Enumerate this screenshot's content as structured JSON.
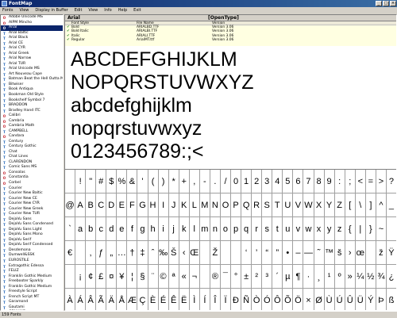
{
  "window": {
    "title": "FontMap"
  },
  "menu": [
    "Fonts",
    "View",
    "Display in Buffer",
    "Edit",
    "View",
    "Info",
    "Help",
    "Exit"
  ],
  "sidebar": {
    "fonts": [
      {
        "name": "Adobe Unicode MS",
        "type": "ot"
      },
      {
        "name": "AIPM Mincho",
        "type": "ot"
      },
      {
        "name": "Arial",
        "type": "ot",
        "selected": true
      },
      {
        "name": "Arial Baltic",
        "type": "tt"
      },
      {
        "name": "Arial Black",
        "type": "tt"
      },
      {
        "name": "Arial CE",
        "type": "tt"
      },
      {
        "name": "Arial CYR",
        "type": "tt"
      },
      {
        "name": "Arial Greek",
        "type": "tt"
      },
      {
        "name": "Arial Narrow",
        "type": "tt"
      },
      {
        "name": "Arial TUR",
        "type": "tt"
      },
      {
        "name": "Arial Unicode MS",
        "type": "tt"
      },
      {
        "name": "Art Nouveau Cape",
        "type": "tt"
      },
      {
        "name": "Batman Beat the Hell Outta Me",
        "type": "tt"
      },
      {
        "name": "Bitwiser",
        "type": "tt"
      },
      {
        "name": "Book Antiqua",
        "type": "tt"
      },
      {
        "name": "Bookman Old Style",
        "type": "tt"
      },
      {
        "name": "Bookshelf Symbol 7",
        "type": "tt"
      },
      {
        "name": "BRADDON",
        "type": "tt"
      },
      {
        "name": "Bradley Hand ITC",
        "type": "tt"
      },
      {
        "name": "Calibri",
        "type": "ot"
      },
      {
        "name": "Cambria",
        "type": "ot"
      },
      {
        "name": "Cambria Math",
        "type": "ot"
      },
      {
        "name": "CAMPBELL",
        "type": "tt"
      },
      {
        "name": "Candara",
        "type": "ot"
      },
      {
        "name": "Century",
        "type": "tt"
      },
      {
        "name": "Century Gothic",
        "type": "tt"
      },
      {
        "name": "Chat",
        "type": "tt"
      },
      {
        "name": "Chat Lines",
        "type": "tt"
      },
      {
        "name": "CLARENDON",
        "type": "tt"
      },
      {
        "name": "Comic Sans MS",
        "type": "tt"
      },
      {
        "name": "Consolas",
        "type": "ot"
      },
      {
        "name": "Constantia",
        "type": "ot"
      },
      {
        "name": "Corbel",
        "type": "ot"
      },
      {
        "name": "Courier",
        "type": "tt"
      },
      {
        "name": "Courier New Baltic",
        "type": "tt"
      },
      {
        "name": "Courier New CE",
        "type": "tt"
      },
      {
        "name": "Courier New CYR",
        "type": "tt"
      },
      {
        "name": "Courier New Greek",
        "type": "tt"
      },
      {
        "name": "Courier New TUR",
        "type": "tt"
      },
      {
        "name": "DejaVu Sans",
        "type": "tt"
      },
      {
        "name": "DejaVu Sans Condensed",
        "type": "tt"
      },
      {
        "name": "DejaVu Sans Light",
        "type": "tt"
      },
      {
        "name": "DejaVu Sans Mono",
        "type": "tt"
      },
      {
        "name": "DejaVu Serif",
        "type": "tt"
      },
      {
        "name": "DejaVu Serif Condensed",
        "type": "tt"
      },
      {
        "name": "Desdemona",
        "type": "tt"
      },
      {
        "name": "Dumwell&SSK",
        "type": "tt"
      },
      {
        "name": "EUROSTILE",
        "type": "tt"
      },
      {
        "name": "Extragothic Edessa",
        "type": "tt"
      },
      {
        "name": "FELIZ",
        "type": "tt"
      },
      {
        "name": "Franklin Gothic Medium",
        "type": "tt"
      },
      {
        "name": "Freebooter Sparkly",
        "type": "tt"
      },
      {
        "name": "Franklin Gothic Medium",
        "type": "tt"
      },
      {
        "name": "Freestyle Script",
        "type": "tt"
      },
      {
        "name": "French Script MT",
        "type": "tt"
      },
      {
        "name": "Garamond",
        "type": "tt"
      },
      {
        "name": "Gautami",
        "type": "tt"
      },
      {
        "name": "GENUINE",
        "type": "tt"
      },
      {
        "name": "Georgia",
        "type": "tt"
      }
    ]
  },
  "status": "159 Fonts",
  "font_header": {
    "name": "Arial",
    "type": "[OpenType]"
  },
  "style_table": {
    "headers": [
      "Font Style",
      "File Name",
      "Version",
      ""
    ],
    "rows": [
      [
        "Bold",
        "ARIALBD.TTF",
        "Version 3.06",
        ""
      ],
      [
        "Bold Italic",
        "ARIALBI.TTF",
        "Version 3.06",
        ""
      ],
      [
        "Italic",
        "ARIALI.TTF",
        "Version 3.06",
        ""
      ],
      [
        "Regular",
        "ArialMT.ttf",
        "Version 3.06",
        ""
      ]
    ]
  },
  "preview": {
    "lines": [
      "ABCDEFGHIJKLM",
      "NOPQRSTUVWXYZ",
      "abcdefghijklm",
      "nopqrstuvwxyz",
      "0123456789:;<"
    ]
  },
  "glyph_rows": [
    [
      " ",
      "!",
      "\"",
      "#",
      "$",
      "%",
      "&",
      "'",
      "(",
      ")",
      "*",
      "+",
      ",",
      "-",
      ".",
      "/",
      "0",
      "1",
      "2",
      "3",
      "4",
      "5",
      "6",
      "7",
      "8",
      "9",
      ":",
      ";",
      "<",
      "=",
      ">",
      "?"
    ],
    [
      "@",
      "A",
      "B",
      "C",
      "D",
      "E",
      "F",
      "G",
      "H",
      "I",
      "J",
      "K",
      "L",
      "M",
      "N",
      "O",
      "P",
      "Q",
      "R",
      "S",
      "T",
      "U",
      "V",
      "W",
      "X",
      "Y",
      "Z",
      "[",
      "\\",
      "]",
      "^",
      "_"
    ],
    [
      "`",
      "a",
      "b",
      "c",
      "d",
      "e",
      "f",
      "g",
      "h",
      "i",
      "j",
      "k",
      "l",
      "m",
      "n",
      "o",
      "p",
      "q",
      "r",
      "s",
      "t",
      "u",
      "v",
      "w",
      "x",
      "y",
      "z",
      "{",
      "|",
      "}",
      "~",
      ""
    ],
    [
      "€",
      "",
      "‚",
      "ƒ",
      "„",
      "…",
      "†",
      "‡",
      "ˆ",
      "‰",
      "Š",
      "‹",
      "Œ",
      "",
      "Ž",
      "",
      "",
      "‘",
      "’",
      "“",
      "”",
      "•",
      "–",
      "—",
      "˜",
      "™",
      "š",
      "›",
      "œ",
      "",
      "ž",
      "Ÿ"
    ],
    [
      " ",
      "¡",
      "¢",
      "£",
      "¤",
      "¥",
      "¦",
      "§",
      "¨",
      "©",
      "ª",
      "«",
      "¬",
      "",
      "®",
      "¯",
      "°",
      "±",
      "²",
      "³",
      "´",
      "µ",
      "¶",
      "·",
      "¸",
      "¹",
      "º",
      "»",
      "¼",
      "½",
      "¾",
      "¿"
    ],
    [
      "À",
      "Á",
      "Â",
      "Ã",
      "Ä",
      "Å",
      "Æ",
      "Ç",
      "È",
      "É",
      "Ê",
      "Ë",
      "Ì",
      "Í",
      "Î",
      "Ï",
      "Ð",
      "Ñ",
      "Ò",
      "Ó",
      "Ô",
      "Õ",
      "Ö",
      "×",
      "Ø",
      "Ù",
      "Ú",
      "Û",
      "Ü",
      "Ý",
      "Þ",
      "ß"
    ]
  ]
}
